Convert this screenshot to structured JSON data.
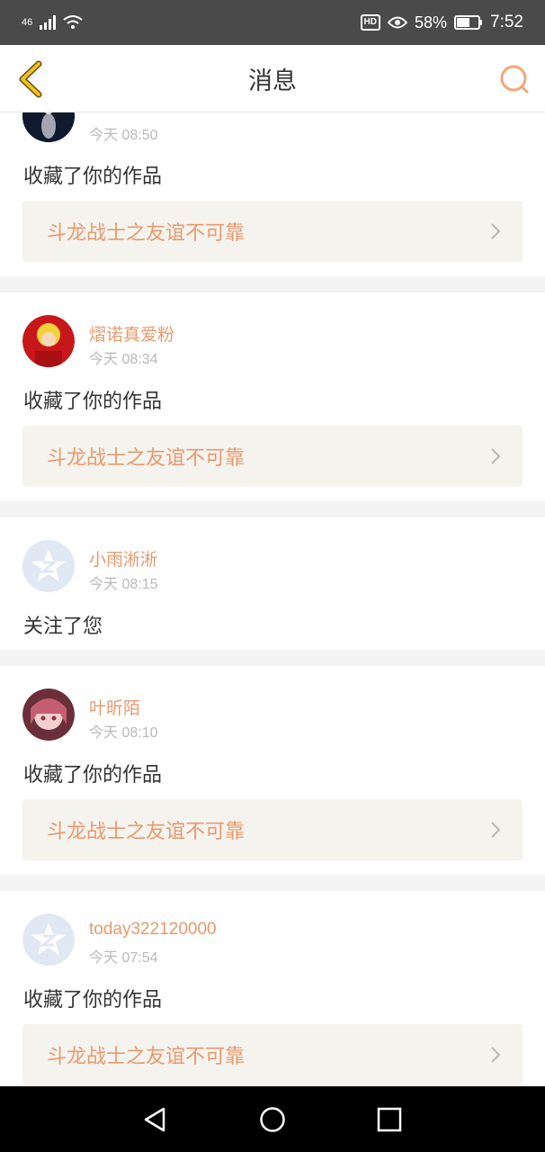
{
  "status": {
    "network": "46",
    "battery": "58%",
    "time": "7:52",
    "hd": "HD"
  },
  "header": {
    "title": "消息"
  },
  "messages": [
    {
      "user": "",
      "time": "今天 08:50",
      "action": "收藏了你的作品",
      "work": "斗龙战士之友谊不可靠"
    },
    {
      "user": "熠诺真爱粉",
      "time": "今天 08:34",
      "action": "收藏了你的作品",
      "work": "斗龙战士之友谊不可靠"
    },
    {
      "user": "小雨淅淅",
      "time": "今天 08:15",
      "action": "关注了您",
      "work": ""
    },
    {
      "user": "叶昕陌",
      "time": "今天 08:10",
      "action": "收藏了你的作品",
      "work": "斗龙战士之友谊不可靠"
    },
    {
      "user": "today322120000",
      "time": "今天 07:54",
      "action": "收藏了你的作品",
      "work": "斗龙战士之友谊不可靠"
    }
  ],
  "colors": {
    "accent": "#e79a6d",
    "back_arrow": "#f2b705",
    "card_bg": "#f4f3ee"
  },
  "icons": [
    "back-arrow-icon",
    "search-icon",
    "chevron-right-icon",
    "default-avatar-icon",
    "nav-back-icon",
    "nav-home-icon",
    "nav-recents-icon"
  ]
}
